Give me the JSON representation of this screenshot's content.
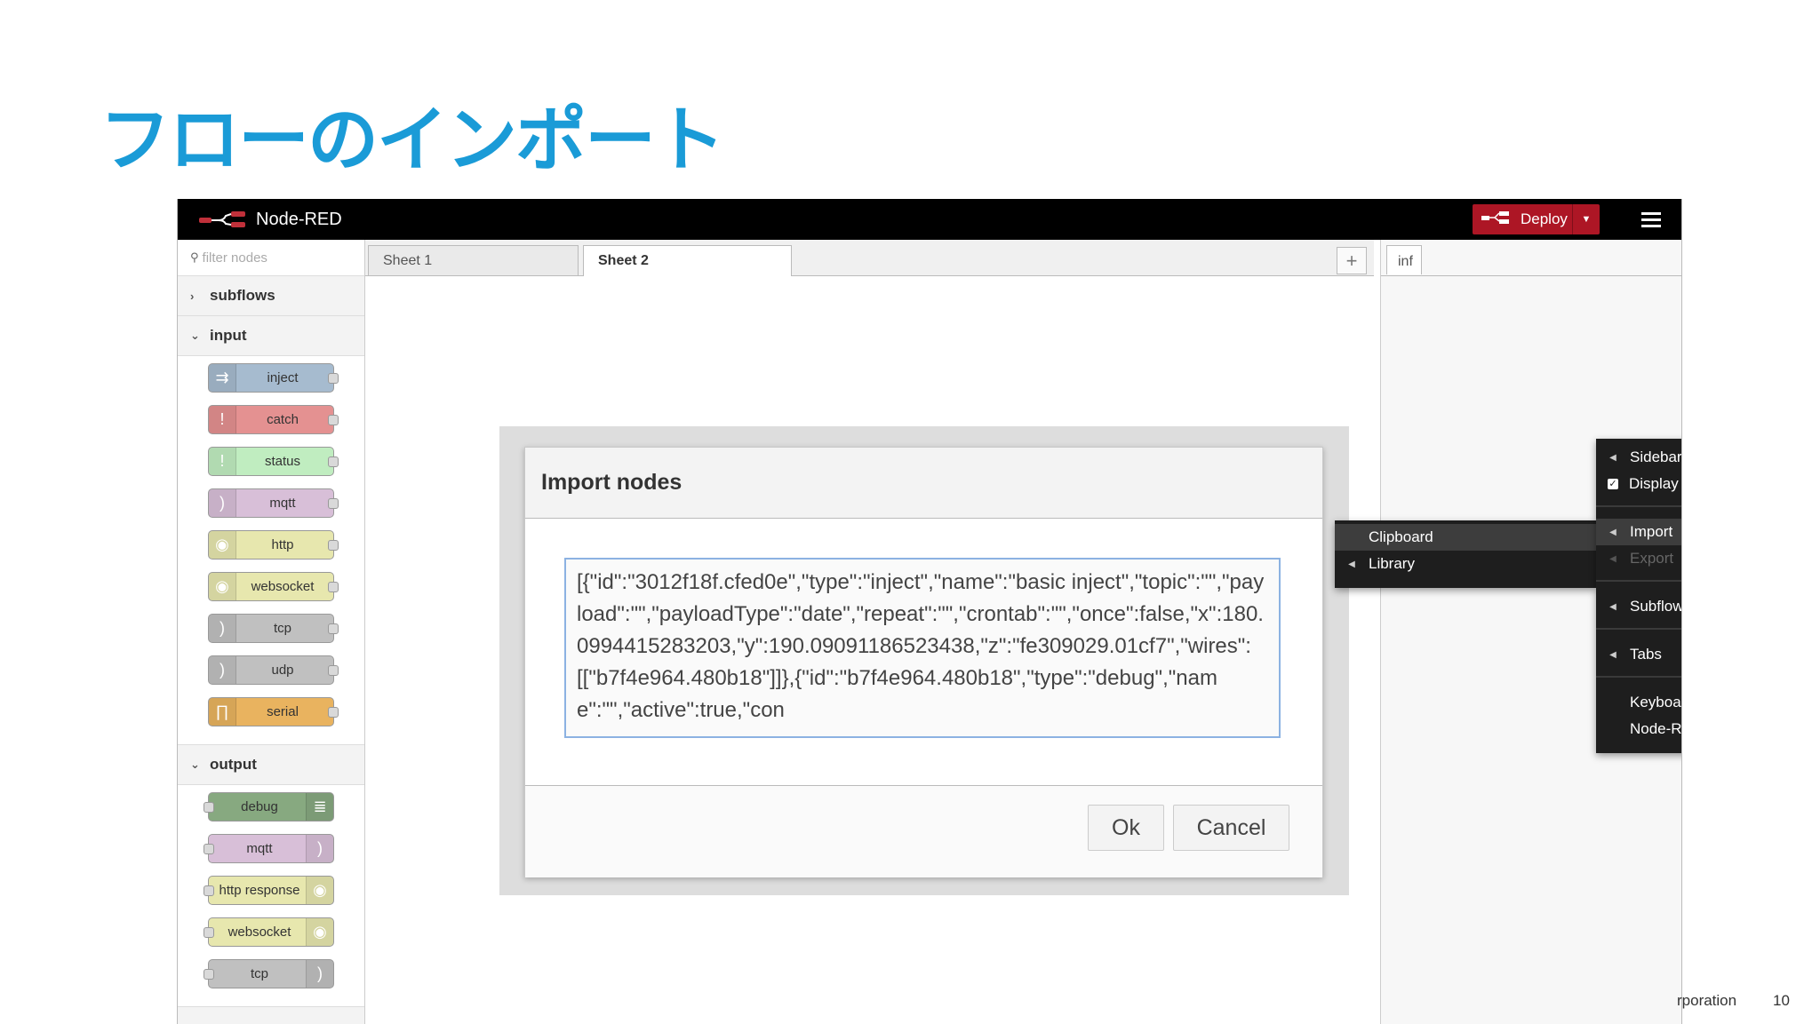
{
  "slide": {
    "title": "フローのインポート",
    "footer_org": "rporation",
    "page_number": "10"
  },
  "app": {
    "brand": "Node-RED",
    "deploy_label": "Deploy"
  },
  "palette": {
    "filter_placeholder": "filter nodes",
    "categories": [
      {
        "label": "subflows"
      },
      {
        "label": "input"
      },
      {
        "label": "output"
      }
    ],
    "input_nodes": [
      {
        "label": "inject",
        "color": "#a6bbcf"
      },
      {
        "label": "catch",
        "color": "#e49191"
      },
      {
        "label": "status",
        "color": "#c0edc0"
      },
      {
        "label": "mqtt",
        "color": "#d8bfd8"
      },
      {
        "label": "http",
        "color": "#e7e7ae"
      },
      {
        "label": "websocket",
        "color": "#e7e7ae"
      },
      {
        "label": "tcp",
        "color": "#c0c0c0"
      },
      {
        "label": "udp",
        "color": "#c0c0c0"
      },
      {
        "label": "serial",
        "color": "#e9b35f"
      }
    ],
    "output_nodes": [
      {
        "label": "debug",
        "color": "#87a980"
      },
      {
        "label": "mqtt",
        "color": "#d8bfd8"
      },
      {
        "label": "http response",
        "color": "#e7e7ae"
      },
      {
        "label": "websocket",
        "color": "#e7e7ae"
      },
      {
        "label": "tcp",
        "color": "#c0c0c0"
      }
    ]
  },
  "workspace": {
    "tabs": [
      {
        "label": "Sheet 1"
      },
      {
        "label": "Sheet 2"
      }
    ],
    "add_tab": "+"
  },
  "sidebar": {
    "tab_label": "inf"
  },
  "dialog": {
    "title": "Import nodes",
    "textarea_value": "[{\"id\":\"3012f18f.cfed0e\",\"type\":\"inject\",\"name\":\"basic inject\",\"topic\":\"\",\"payload\":\"\",\"payloadType\":\"date\",\"repeat\":\"\",\"crontab\":\"\",\"once\":false,\"x\":180.0994415283203,\"y\":190.09091186523438,\"z\":\"fe309029.01cf7\",\"wires\":[[\"b7f4e964.480b18\"]]},{\"id\":\"b7f4e964.480b18\",\"type\":\"debug\",\"name\":\"\",\"active\":true,\"con",
    "ok_label": "Ok",
    "cancel_label": "Cancel"
  },
  "import_submenu": {
    "items": [
      {
        "label": "Clipboard"
      },
      {
        "label": "Library"
      }
    ]
  },
  "main_menu": {
    "items": [
      {
        "label": "Sidebar"
      },
      {
        "label": "Display Node Status",
        "checked": true
      },
      {
        "label": "Import"
      },
      {
        "label": "Export",
        "disabled": true
      },
      {
        "label": "Subflows"
      },
      {
        "label": "Tabs"
      },
      {
        "label": "Keyboard Shortcuts"
      },
      {
        "label": "Node-RED Website"
      }
    ]
  }
}
